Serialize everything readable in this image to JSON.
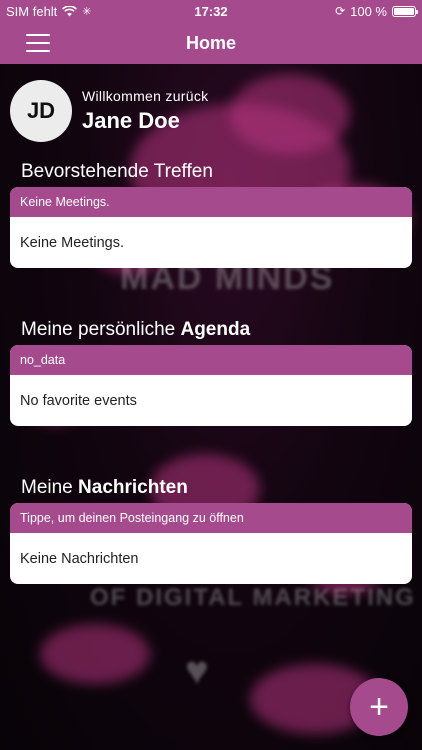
{
  "status_bar": {
    "carrier": "SIM fehlt",
    "time": "17:32",
    "battery_percent": "100 %",
    "battery_level": 1.0
  },
  "nav": {
    "title": "Home",
    "menu_icon": "hamburger-menu-icon"
  },
  "profile": {
    "initials": "JD",
    "welcome": "Willkommen zurück",
    "name": "Jane Doe"
  },
  "sections": {
    "meetings": {
      "title": "Bevorstehende Treffen",
      "header": "Keine Meetings.",
      "body": "Keine Meetings."
    },
    "agenda": {
      "title_regular": "Meine persönliche ",
      "title_bold": "Agenda",
      "header": "no_data",
      "body": "No favorite events"
    },
    "messages": {
      "title_regular": "Meine ",
      "title_bold": "Nachrichten",
      "header": "Tippe, um deinen Posteingang zu öffnen",
      "body": "Keine Nachrichten"
    }
  },
  "fab": {
    "label": "+"
  },
  "colors": {
    "brand": "#a54a8c",
    "background": "#0b0b0b",
    "card": "#ffffff"
  }
}
